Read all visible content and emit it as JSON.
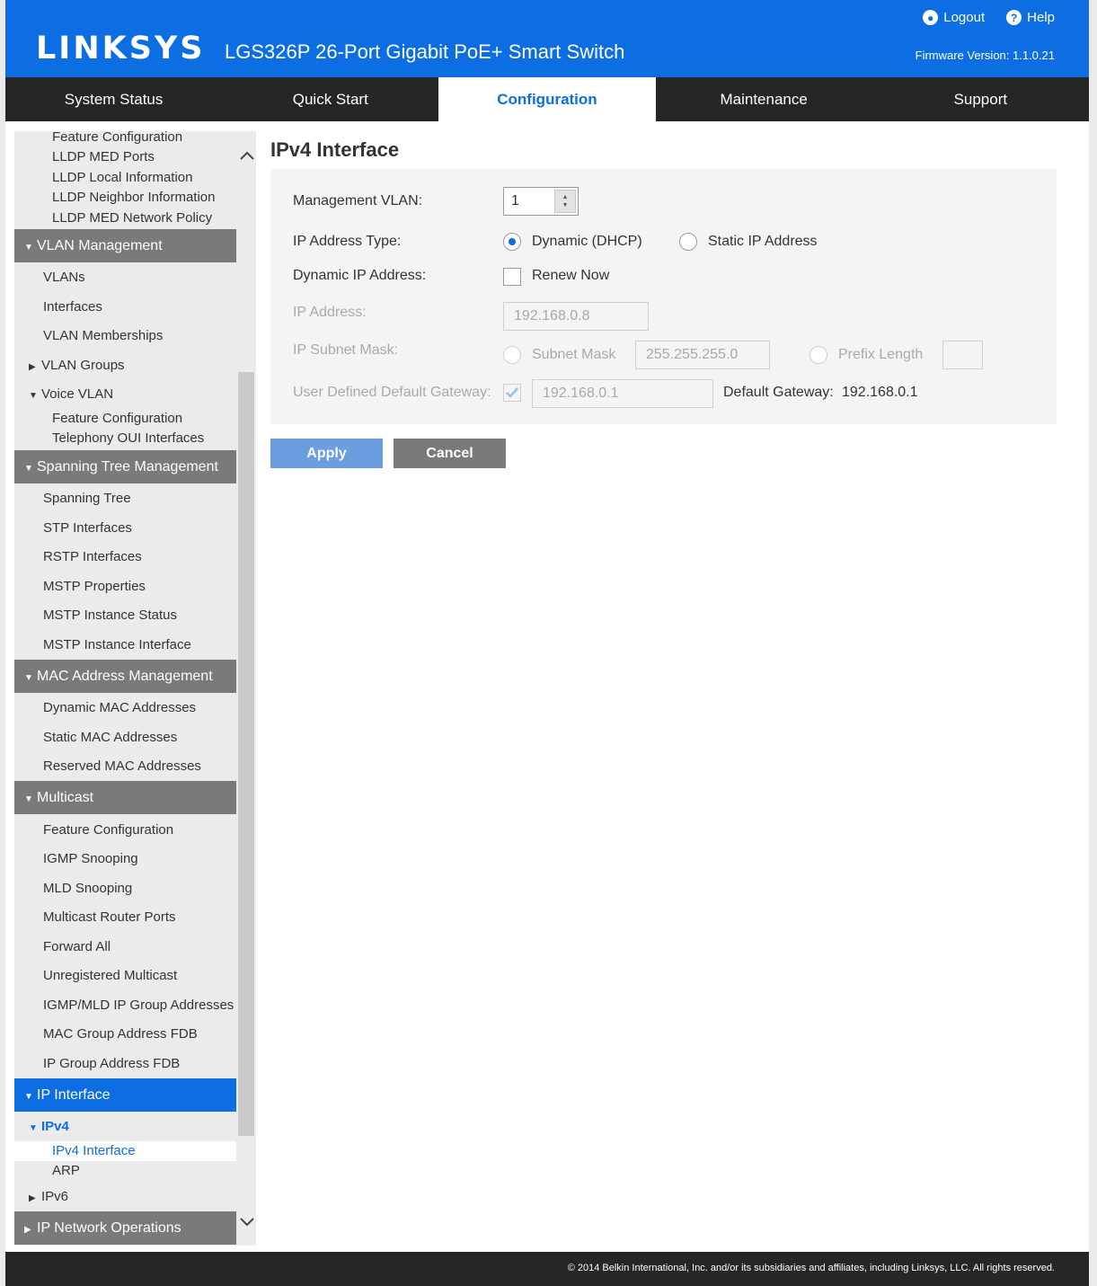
{
  "header": {
    "logo": "LINKSYS",
    "product": "LGS326P 26-Port Gigabit PoE+ Smart Switch",
    "logout": "Logout",
    "help": "Help",
    "firmware": "Firmware Version: 1.1.0.21",
    "brand_color": "#0d6ee3"
  },
  "nav": {
    "tabs": [
      "System Status",
      "Quick Start",
      "Configuration",
      "Maintenance",
      "Support"
    ],
    "active": "Configuration"
  },
  "sidebar": {
    "items": [
      "Feature Configuration",
      "LLDP MED Ports",
      "LLDP Local Information",
      "LLDP Neighbor Information",
      "LLDP MED Network Policy",
      "VLAN Management",
      "VLANs",
      "Interfaces",
      "VLAN Memberships",
      "VLAN Groups",
      "Voice VLAN",
      "Feature Configuration",
      "Telephony OUI Interfaces",
      "Spanning Tree Management",
      "Spanning Tree",
      "STP Interfaces",
      "RSTP Interfaces",
      "MSTP Properties",
      "MSTP Instance Status",
      "MSTP Instance Interface",
      "MAC Address Management",
      "Dynamic MAC Addresses",
      "Static MAC Addresses",
      "Reserved MAC Addresses",
      "Multicast",
      "Feature Configuration",
      "IGMP Snooping",
      "MLD Snooping",
      "Multicast Router Ports",
      "Forward All",
      "Unregistered Multicast",
      "IGMP/MLD IP Group Addresses",
      "MAC Group Address FDB",
      "IP Group Address FDB",
      "IP Interface",
      "IPv4",
      "IPv4 Interface",
      "ARP",
      "IPv6",
      "IP Network Operations"
    ]
  },
  "main": {
    "title": "IPv4 Interface",
    "management_vlan_label": "Management VLAN:",
    "management_vlan_value": "1",
    "ip_type_label": "IP Address Type:",
    "ip_type_dhcp": "Dynamic (DHCP)",
    "ip_type_static": "Static IP Address",
    "ip_type_selected": "Dynamic (DHCP)",
    "dynamic_ip_label": "Dynamic IP Address:",
    "renew_now": "Renew Now",
    "ip_address_label": "IP Address:",
    "ip_address_value": "192.168.0.8",
    "subnet_label": "IP Subnet Mask:",
    "subnet_mask_option": "Subnet Mask",
    "subnet_mask_value": "255.255.255.0",
    "prefix_length_option": "Prefix Length",
    "prefix_length_value": "",
    "gateway_label": "User Defined Default Gateway:",
    "gateway_value": "192.168.0.1",
    "default_gateway_label": "Default Gateway:",
    "default_gateway_value": "192.168.0.1",
    "apply": "Apply",
    "cancel": "Cancel"
  },
  "footer": {
    "copyright": "© 2014 Belkin International, Inc. and/or its subsidiaries and affiliates, including Linksys, LLC. All rights reserved."
  }
}
